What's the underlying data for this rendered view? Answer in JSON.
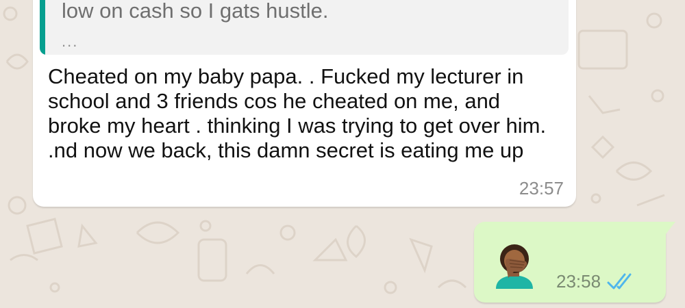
{
  "chat": {
    "incoming": {
      "quoted_text": "low on cash so I gats hustle.",
      "quoted_more": "...",
      "text": "Cheated on my baby papa. . Fucked my lecturer in school and 3 friends cos he cheated on me, and broke my heart . thinking I was trying to get over him. .nd now we back, this damn secret is eating me up",
      "time": "23:57"
    },
    "outgoing": {
      "emoji": "face-palm-icon",
      "time": "23:58",
      "status": "read-double-check-icon"
    }
  },
  "colors": {
    "background": "#ece5dd",
    "incoming_bubble": "#ffffff",
    "outgoing_bubble": "#dcf8c6",
    "quote_bar": "#069f8f",
    "read_ticks": "#4fb6ec"
  }
}
